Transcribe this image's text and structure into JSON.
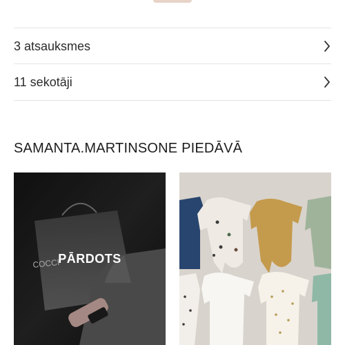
{
  "profile": {
    "reviews_label": "3 atsauksmes",
    "followers_label": "11 sekotāji"
  },
  "section": {
    "title": "SAMANTA.MARTINSONE PIEDĀVĀ"
  },
  "items": [
    {
      "status_label": "PĀRDOTS",
      "bag_text": "COCCI"
    },
    {
      "status_label": ""
    }
  ],
  "colors": {
    "accent_pill": "#e7d3c7",
    "divider": "#e3e3e3",
    "text": "#1f1f1f"
  },
  "icons": {
    "row_chevron": "chevron-right-icon"
  }
}
